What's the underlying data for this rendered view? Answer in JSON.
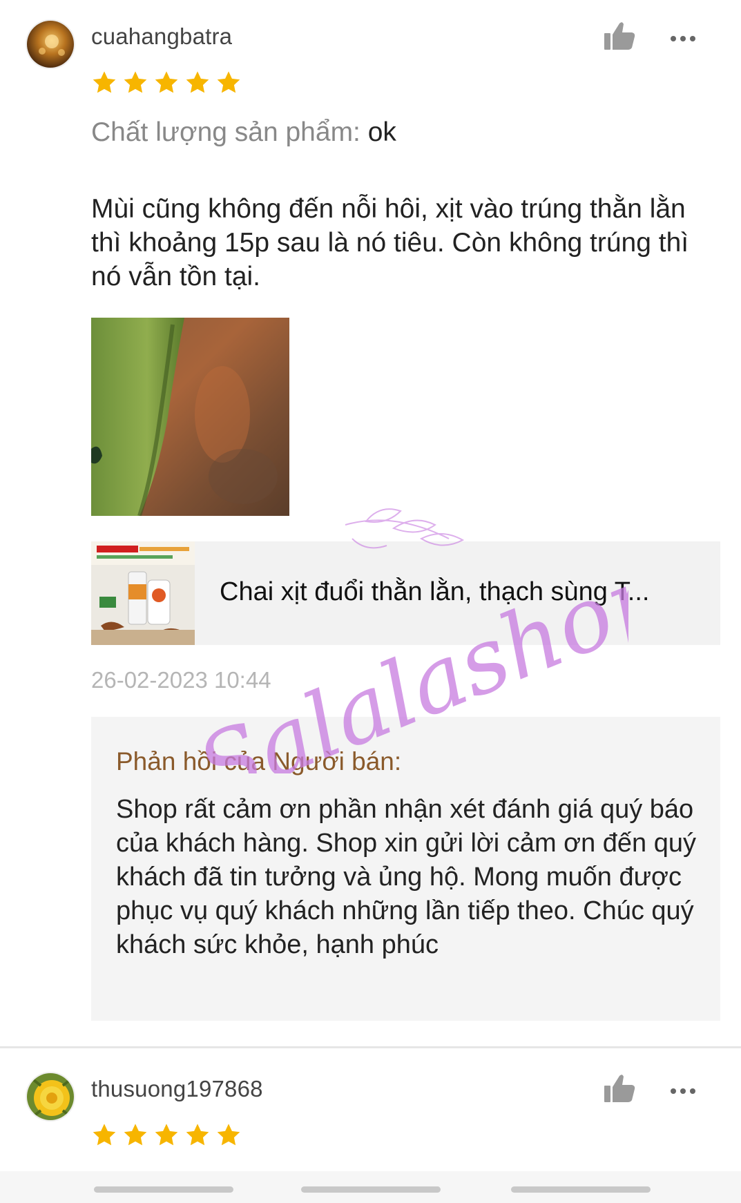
{
  "reviews": [
    {
      "username": "cuahangbatra",
      "rating": 5,
      "quality_label": "Chất lượng sản phẩm: ",
      "quality_value": "ok",
      "comment": "Mùi cũng không đến nỗi hôi, xịt vào trúng thằn lằn thì khoảng 15p sau là nó tiêu. Còn không trúng thì nó vẫn tồn tại.",
      "product_name": "Chai xịt đuổi thằn lằn, thạch sùng T...",
      "timestamp": "26-02-2023 10:44",
      "seller_reply_title": "Phản hồi của Người bán:",
      "seller_reply_body": "Shop rất cảm ơn phần nhận xét đánh giá quý báo của khách hàng. Shop xin gửi lời cảm ơn đến quý khách đã tin tưởng và ủng hộ. Mong muốn được phục vụ quý khách những lần tiếp theo. Chúc quý khách sức khỏe, hạnh phúc"
    },
    {
      "username": "thusuong197868",
      "rating": 5
    }
  ],
  "watermark_text": "Salalashop",
  "colors": {
    "star": "#f7b500",
    "seller_title": "#8a5a2b",
    "watermark": "#c77be0",
    "icon_gray": "#9a9a9a"
  }
}
